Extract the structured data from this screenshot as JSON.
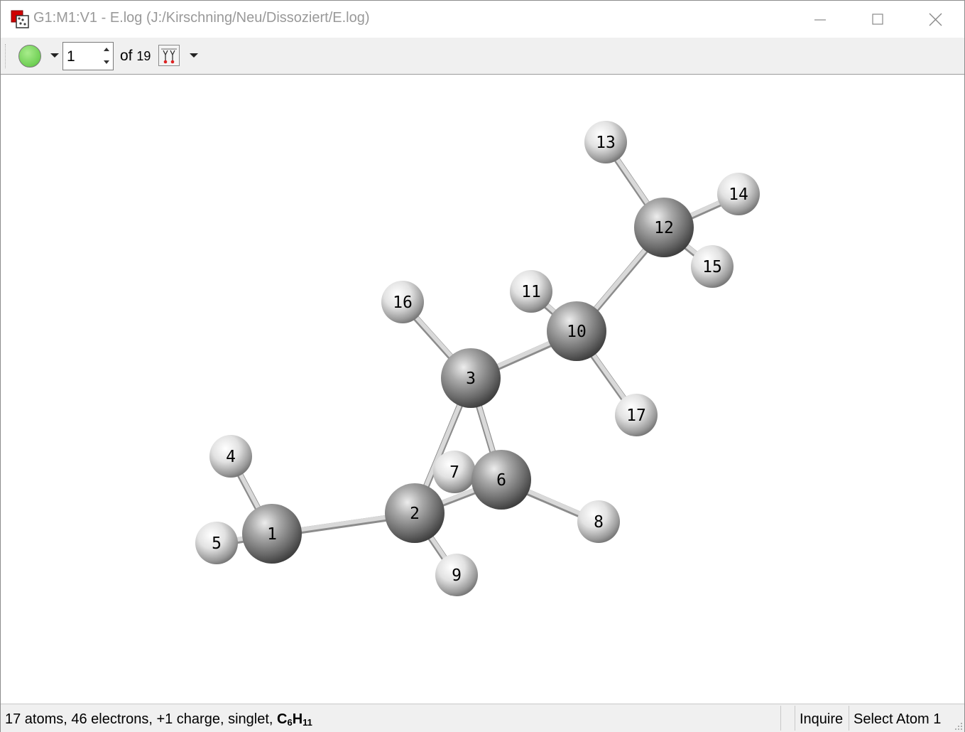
{
  "window": {
    "title": "G1:M1:V1 - E.log (J:/Kirschning/Neu/Dissoziert/E.log)"
  },
  "toolbar": {
    "status_dot_color": "#6fcf54",
    "frame_value": "1",
    "of_label": "of",
    "frame_total": "19",
    "animate_icon": "animate-molecule-icon"
  },
  "molecule": {
    "atoms": [
      {
        "label": "1",
        "element": "C"
      },
      {
        "label": "2",
        "element": "C"
      },
      {
        "label": "3",
        "element": "C"
      },
      {
        "label": "4",
        "element": "H"
      },
      {
        "label": "5",
        "element": "H"
      },
      {
        "label": "6",
        "element": "C"
      },
      {
        "label": "7",
        "element": "H"
      },
      {
        "label": "8",
        "element": "H"
      },
      {
        "label": "9",
        "element": "H"
      },
      {
        "label": "10",
        "element": "C"
      },
      {
        "label": "11",
        "element": "H"
      },
      {
        "label": "12",
        "element": "C"
      },
      {
        "label": "13",
        "element": "H"
      },
      {
        "label": "14",
        "element": "H"
      },
      {
        "label": "15",
        "element": "H"
      },
      {
        "label": "16",
        "element": "H"
      },
      {
        "label": "17",
        "element": "H"
      }
    ]
  },
  "status": {
    "summary": "17 atoms, 46 electrons, +1 charge, singlet,",
    "formula_c": "C",
    "formula_c_count": "6",
    "formula_h": "H",
    "formula_h_count": "11",
    "mode": "Inquire",
    "action": "Select Atom 1"
  }
}
